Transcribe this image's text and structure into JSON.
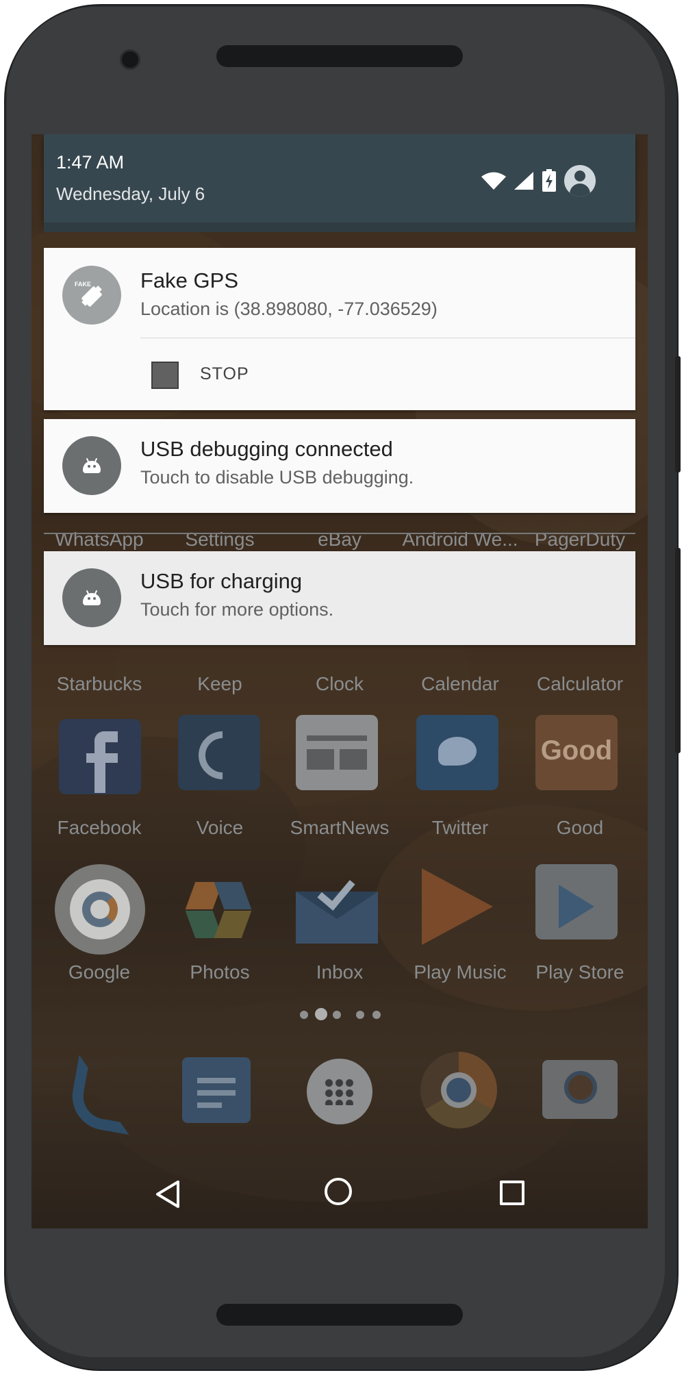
{
  "status_bar": {
    "time": "1:47 AM",
    "date": "Wednesday, July 6",
    "icons": [
      "wifi-icon",
      "signal-icon",
      "battery-charging-icon",
      "account-icon"
    ]
  },
  "notifications": [
    {
      "app_icon": "satellite-icon",
      "icon_text": "FAKE",
      "title": "Fake GPS",
      "text": "Location is (38.898080, -77.036529)",
      "action": {
        "icon": "stop-icon",
        "label": "STOP"
      }
    },
    {
      "app_icon": "android-icon",
      "title": "USB debugging connected",
      "text": "Touch to disable USB debugging."
    },
    {
      "app_icon": "android-icon",
      "title": "USB for charging",
      "text": "Touch for more options."
    }
  ],
  "home_screen": {
    "row0": [
      "WhatsApp",
      "Settings",
      "eBay",
      "Android We...",
      "PagerDuty"
    ],
    "row1": [
      "Starbucks",
      "Keep",
      "Clock",
      "Calendar",
      "Calculator"
    ],
    "row2": [
      "Facebook",
      "Voice",
      "SmartNews",
      "Twitter",
      "Good"
    ],
    "row3": [
      "Google",
      "Photos",
      "Inbox",
      "Play Music",
      "Play Store"
    ],
    "good_icon_text": "Good",
    "page_indicator": {
      "count": 5,
      "current": 2
    },
    "dock": [
      "phone-icon",
      "messenger-icon",
      "app-drawer-icon",
      "chrome-icon",
      "camera-icon"
    ]
  },
  "nav_bar": [
    "back-icon",
    "home-icon",
    "recents-icon"
  ],
  "colors": {
    "header_bg": "#37474f",
    "card_bg": "#fafafa",
    "phone_body": "#2e2f31"
  }
}
